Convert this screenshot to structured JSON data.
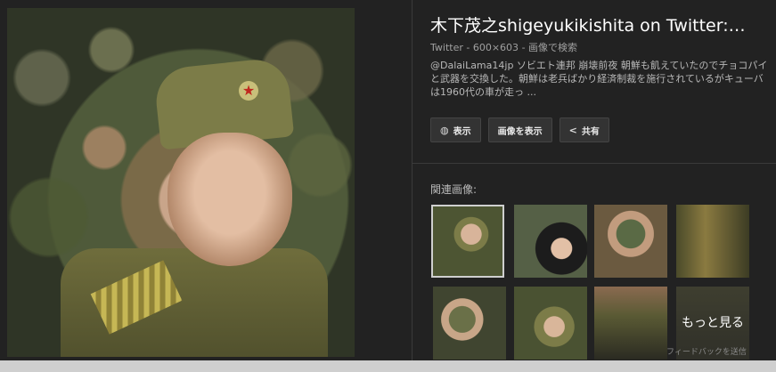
{
  "result": {
    "title": "木下茂之shigeyukikishita on Twitter:…",
    "source": "Twitter",
    "dimensions": "600×603",
    "search_by_image": "画像で検索",
    "description": "@DalaiLama14jp ソビエト連邦 崩壊前夜 朝鮮も飢えていたのでチョコパイと武器を交換した。朝鮮は老兵ばかり経済制裁を施行されているがキューバは1960代の車が走っ ..."
  },
  "actions": {
    "view_label": "表示",
    "view_image_label": "画像を表示",
    "share_label": "共有"
  },
  "related": {
    "label": "関連画像:",
    "more_label": "もっと見る"
  },
  "footer": {
    "feedback": "フィードバックを送信"
  },
  "icons": [
    "globe-icon",
    "share-icon",
    "star-icon"
  ],
  "colors": {
    "background": "#222222",
    "button": "#333333",
    "title": "#ffffff"
  }
}
